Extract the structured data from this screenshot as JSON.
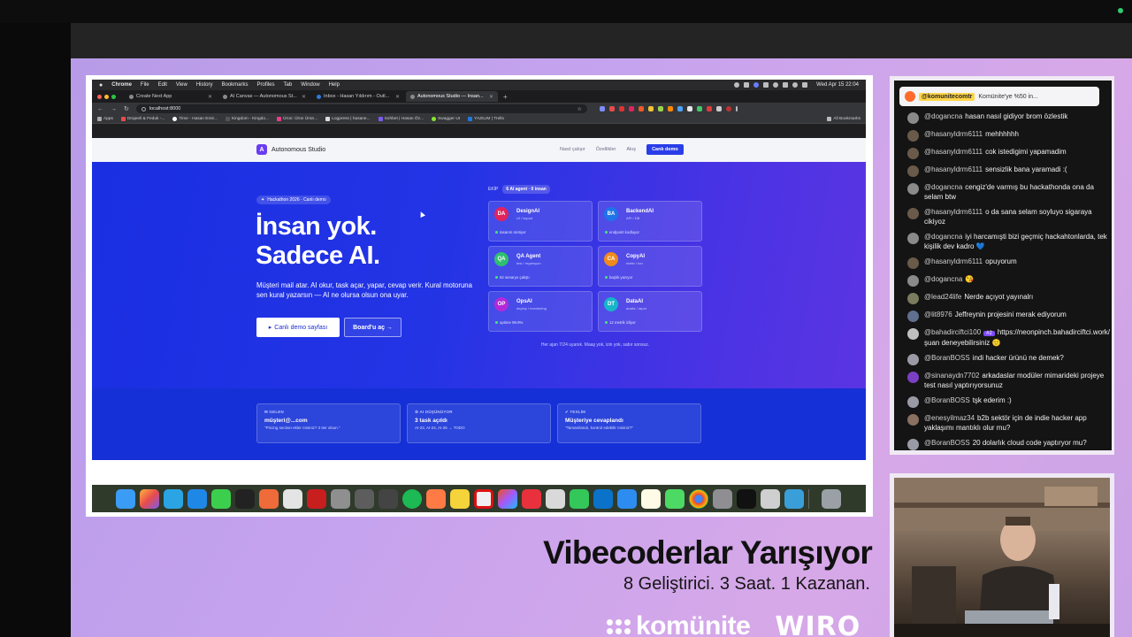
{
  "macos": {
    "app": "Chrome",
    "menu": [
      "File",
      "Edit",
      "View",
      "History",
      "Bookmarks",
      "Profiles",
      "Tab",
      "Window",
      "Help"
    ],
    "clock": "Wed Apr 15  22:04"
  },
  "browser": {
    "tabs": [
      {
        "title": "Create Next App",
        "active": false
      },
      {
        "title": "AI Canvas — Autonomous St...",
        "active": false
      },
      {
        "title": "Inbox - Hasan Yıldırım - Outl...",
        "active": false
      },
      {
        "title": "Autonomous Studio — İnsan...",
        "active": true
      }
    ],
    "url": "localhost:8000",
    "bookmarks": [
      "Apps",
      "Drajeeli & Feduk -...",
      "Time - Hasan Emir...",
      "Kingdom - Kingdo...",
      "Ürün: Ürün Ürün...",
      "Logpress | hasane...",
      "Sohbet | Hasan Öz...",
      "Swagger UI",
      "YAZILIM | Trello"
    ],
    "all_bookmarks": "All Bookmarks"
  },
  "site": {
    "brand": "Autonomous Studio",
    "brand_logo": "A",
    "nav": {
      "how": "Nasıl çalışır",
      "features": "Özellikler",
      "flow": "Akış",
      "cta": "Canlı demo"
    },
    "hero": {
      "pill": "Hackathon 2026 · Canlı demo",
      "title_line1": "İnsan yok.",
      "title_line2": "Sadece AI.",
      "desc": "Müşteri mail atar. AI okur, task açar, yapar, cevap verir. Kural motoruna sen kural yazarsın — AI ne olursa olsun ona uyar.",
      "btn_primary": "Canlı demo sayfası",
      "btn_primary_icon": "▸",
      "btn_secondary": "Board'u aç →"
    },
    "team": {
      "label": "EKİP",
      "chip": "6 AI agent · 0 insan",
      "cards": [
        {
          "initials": "DA",
          "name": "DesignAI",
          "role": "UI / layout",
          "status": "tasarım üretiyor",
          "color": "#e0245e"
        },
        {
          "initials": "BA",
          "name": "BackendAI",
          "role": "API / DB",
          "status": "endpoint kodluyor",
          "color": "#1e74e8"
        },
        {
          "initials": "QA",
          "name": "QA Agent",
          "role": "test / regresyon",
          "status": "62 senaryo çalıştı",
          "color": "#2fbf71"
        },
        {
          "initials": "CA",
          "name": "CopyAI",
          "role": "metin / ton",
          "status": "başlık yazıyor",
          "color": "#f08a1c"
        },
        {
          "initials": "OP",
          "name": "OpsAI",
          "role": "deploy / monitoring",
          "status": "uptime 99.9%",
          "color": "#b22ad8"
        },
        {
          "initials": "DT",
          "name": "DataAI",
          "role": "analiz / rapor",
          "status": "12 metrik izliyor",
          "color": "#18b5c9"
        }
      ],
      "footer": "Her ajan 7/24 uyanık. Maaş yok, izin yok, sabır sonsuz."
    },
    "flow": [
      {
        "tag": "✉ GELEN",
        "title": "müşteri@...com",
        "sub": "\"Pricing section ekler misiniz? 3 tier olsun.\""
      },
      {
        "tag": "⚙ AI DÜŞÜNÜYOR",
        "title": "3 task açıldı",
        "sub": "AI-23, AI-24, AI-25 → TODO"
      },
      {
        "tag": "✔ TESLİM",
        "title": "Müşteriye cevaplandı",
        "sub": "\"Tamamlandı, kontrol edebilir misiniz?\""
      }
    ]
  },
  "overlay": {
    "headline": "Vibecoderlar Yarışıyor",
    "subline": "8 Geliştirici. 3 Saat. 1 Kazanan.",
    "logo_komunite": "komünite",
    "logo_wiro": "WIRO"
  },
  "chat": {
    "pinned_user": "@komunitecomtr",
    "pinned_text": "Komünite'ye %50 in...",
    "messages": [
      {
        "user": "@dogancna",
        "text": "hasan nasıl gidiyor brom özlestik",
        "color": "#8a8a8a"
      },
      {
        "user": "@hasanyldrm6111",
        "text": "mehhhhhh",
        "color": "#6a5a4a"
      },
      {
        "user": "@hasanyldrm6111",
        "text": "cok istedigimi yapamadim",
        "color": "#6a5a4a"
      },
      {
        "user": "@hasanyldrm6111",
        "text": "sensizlik bana yaramadi :(",
        "color": "#6a5a4a"
      },
      {
        "user": "@dogancna",
        "text": "cengiz'de varmış bu hackathonda ona da selam btw",
        "color": "#8a8a8a"
      },
      {
        "user": "@hasanyldrm6111",
        "text": "o da sana selam soyluyo sigaraya cikiyoz",
        "color": "#6a5a4a"
      },
      {
        "user": "@dogancna",
        "text": "iyi harcamışti bizi geçmiç hackahtonlarda, tek kişilik dev kadro 💙",
        "color": "#8a8a8a"
      },
      {
        "user": "@hasanyldrm6111",
        "text": "opuyorum",
        "color": "#6a5a4a"
      },
      {
        "user": "@dogancna",
        "text": "😘",
        "color": "#8a8a8a"
      },
      {
        "user": "@lead24life",
        "text": "Nerde açıyot yayınalrı",
        "color": "#7b7b5e"
      },
      {
        "user": "@lit8976",
        "text": "Jeffreynin projesini merak ediyorum",
        "color": "#5f6f8f"
      },
      {
        "user": "@bahadirciftci100",
        "badge": "#2",
        "text": "https://neonpinch.bahadirciftci.work/ şuan deneyebilirsiniz 🙂",
        "color": "#c0c0c0"
      },
      {
        "user": "@BoranBOSS",
        "text": "indi hacker ürünü ne demek?",
        "color": "#9a9aa6"
      },
      {
        "user": "@sinanaydn7702",
        "text": "arkadaslar modüler mimarideki projeye test nasıl yaptırıyorsunuz",
        "color": "#7a3fc2"
      },
      {
        "user": "@BoranBOSS",
        "text": "tşk ederim :)",
        "color": "#9a9aa6"
      },
      {
        "user": "@enesyilmaz34",
        "text": "b2b sektör için de indie hacker app yaklaşımı mantıklı olur mu?",
        "color": "#8a7060"
      },
      {
        "user": "@BoranBOSS",
        "text": "20 dolarlık cloud code yaptıryor mu?",
        "color": "#9a9aa6"
      }
    ]
  }
}
